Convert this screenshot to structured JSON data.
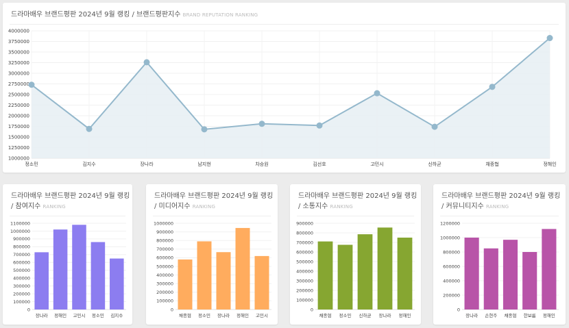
{
  "main_card": {
    "title": "드라마배우 브랜드평판 2024년 9월 랭킹 / 브랜드평판지수",
    "subtitle": "BRAND REPUTATION RANKING"
  },
  "cards": [
    {
      "title_line1": "드라마배우 브랜드평판 2024년 9월 랭킹",
      "title_line2": "/ 참여지수",
      "subtitle": "RANKING"
    },
    {
      "title_line1": "드라마배우 브랜드평판 2024년 9월 랭킹",
      "title_line2": "/ 미디어지수",
      "subtitle": "RANKING"
    },
    {
      "title_line1": "드라마배우 브랜드평판 2024년 9월 랭킹",
      "title_line2": "/ 소통지수",
      "subtitle": "RANKING"
    },
    {
      "title_line1": "드라마배우 브랜드평판 2024년 9월 랭킹",
      "title_line2": "/ 커뮤니티지수",
      "subtitle": "RANKING"
    }
  ],
  "chart_data": [
    {
      "type": "area",
      "categories": [
        "정소민",
        "김지수",
        "장나라",
        "남지현",
        "차승원",
        "김선호",
        "고민시",
        "신하균",
        "채종협",
        "정해인"
      ],
      "values": [
        2730000,
        1690000,
        3260000,
        1680000,
        1810000,
        1770000,
        2530000,
        1740000,
        2680000,
        3830000
      ],
      "ylim": [
        1000000,
        4000000
      ],
      "yticks": [
        1000000,
        1250000,
        1500000,
        1750000,
        2000000,
        2250000,
        2500000,
        2750000,
        3000000,
        3250000,
        3500000,
        3750000,
        4000000
      ],
      "color": "#94b8cc",
      "fill": "#e6eef3",
      "grid": true
    },
    {
      "type": "bar",
      "categories": [
        "장나라",
        "정해인",
        "고민시",
        "정소민",
        "김지수"
      ],
      "values": [
        730000,
        1020000,
        1080000,
        860000,
        650000
      ],
      "ylim": [
        0,
        1100000
      ],
      "yticks": [
        0,
        100000,
        200000,
        300000,
        400000,
        500000,
        600000,
        700000,
        800000,
        900000,
        1000000,
        1100000
      ],
      "color": "#8c7df0",
      "grid": true
    },
    {
      "type": "bar",
      "categories": [
        "채종협",
        "정소민",
        "장나라",
        "정해인",
        "고민시"
      ],
      "values": [
        580000,
        790000,
        665000,
        945000,
        620000
      ],
      "ylim": [
        0,
        1000000
      ],
      "yticks": [
        0,
        100000,
        200000,
        300000,
        400000,
        500000,
        600000,
        700000,
        800000,
        900000,
        1000000
      ],
      "color": "#ffac5e",
      "grid": true
    },
    {
      "type": "bar",
      "categories": [
        "채종협",
        "정소민",
        "신하균",
        "장나라",
        "정해인"
      ],
      "values": [
        710000,
        675000,
        785000,
        855000,
        750000
      ],
      "ylim": [
        0,
        900000
      ],
      "yticks": [
        0,
        100000,
        200000,
        300000,
        400000,
        500000,
        600000,
        700000,
        800000,
        900000
      ],
      "color": "#86a631",
      "grid": true
    },
    {
      "type": "bar",
      "categories": [
        "장나라",
        "손현주",
        "채종협",
        "한보름",
        "정해인"
      ],
      "values": [
        1000000,
        850000,
        970000,
        800000,
        1120000
      ],
      "ylim": [
        0,
        1200000
      ],
      "yticks": [
        0,
        200000,
        400000,
        600000,
        800000,
        1000000,
        1200000
      ],
      "color": "#b854a8",
      "grid": true
    }
  ]
}
